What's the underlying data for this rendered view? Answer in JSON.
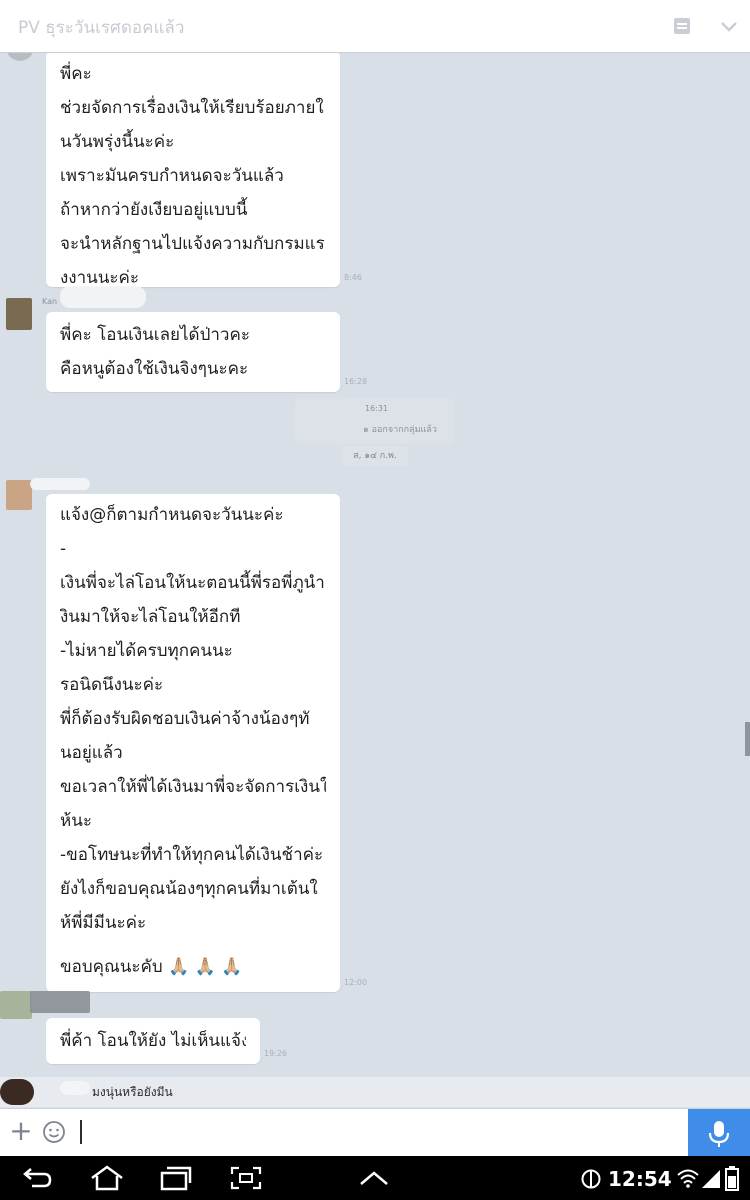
{
  "header": {
    "title": "PV ธุระวันเรศดอคแล้ว",
    "menu_icon": "menu-icon",
    "dropdown_icon": "chevron-down-icon"
  },
  "messages": [
    {
      "lines": [
        "พี่คะ",
        "ช่วยจัดการเรื่องเงินให้เรียบร้อยภายใ",
        "นวันพรุ่งนี้นะค่ะ",
        "เพราะมันครบกำหนดจะวันแล้ว",
        "ถ้าหากว่ายังเงียบอยู่แบบนี้",
        "จะนำหลักฐานไปแจ้งความกับกรมแร",
        "งงานนะค่ะ"
      ],
      "time": "8:46"
    },
    {
      "sender": "Kan",
      "lines": [
        "พี่คะ โอนเงินเลยได้ป่าวคะ",
        "คือหนูต้องใช้เงินจิงๆนะคะ"
      ],
      "time": "16:28"
    },
    {
      "lines": [
        "แจ้ง@ก็ตามกำหนดจะวันนะค่ะ",
        "-",
        "เงินพี่จะไล่โอนให้นะตอนนี้พี่รอพี่ภูนำเ",
        "งินมาให้จะไล่โอนให้อีกที",
        "-ไม่หายได้ครบทุกคนนะ",
        "รอนิดนึงนะค่ะ",
        "พี่ก็ต้องรับผิดชอบเงินค่าจ้างน้องๆทั",
        "นอยู่แล้ว",
        "ขอเวลาให้พี่ได้เงินมาพี่จะจัดการเงินใ",
        "ห้นะ",
        "-ขอโทษนะที่ทำให้ทุกคนได้เงินช้าค่ะ",
        "ยังไงก็ขอบคุณน้องๆทุกคนที่มาเต้นใ",
        "ห้พี่มีมีนะค่ะ"
      ],
      "closing": "ขอบคุณนะคับ 🙏🏼 🙏🏼 🙏🏼",
      "time": "12:00"
    },
    {
      "lines": [
        "พี่ค้า โอนให้ยัง ไม่เห็นแจ้ง"
      ],
      "time": "19:26"
    }
  ],
  "system": {
    "time": "16:31",
    "text": "๑ ออกจากกลุ่มแล้ว",
    "date": "ส, ๑๔ ก.พ."
  },
  "preview": {
    "text": "มงนุ่นหรือยังมีน"
  },
  "input": {
    "placeholder": "",
    "plus_icon": "plus-icon",
    "emoji_icon": "emoji-icon",
    "mic_icon": "mic-icon",
    "accent": "#3f8de9"
  },
  "status": {
    "clock": "12:54"
  }
}
